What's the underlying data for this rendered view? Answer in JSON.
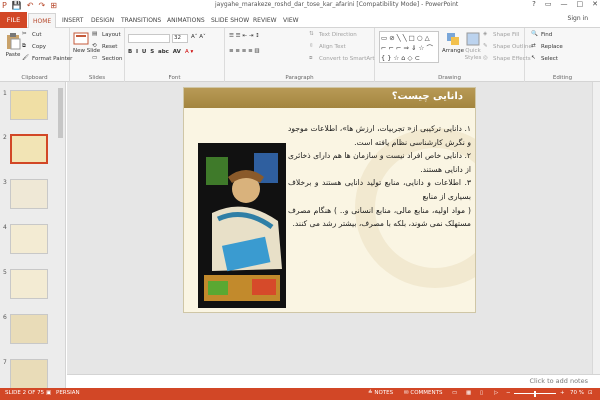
{
  "titlebar": {
    "title": "jaygahe_marakeze_roshd_dar_tose_kar_afarini [Compatibility Mode] - PowerPoint",
    "qat": [
      "P",
      "💾",
      "↶",
      "↷",
      "⊞"
    ],
    "controls": [
      "?",
      "▭",
      "—",
      "□",
      "✕"
    ]
  },
  "tabs": {
    "file": "FILE",
    "items": [
      "HOME",
      "INSERT",
      "DESIGN",
      "TRANSITIONS",
      "ANIMATIONS",
      "SLIDE SHOW",
      "REVIEW",
      "VIEW"
    ],
    "signin": "Sign in"
  },
  "ribbon": {
    "clipboard": {
      "paste": "Paste",
      "cut": "Cut",
      "copy": "Copy",
      "format_painter": "Format Painter",
      "label": "Clipboard"
    },
    "slides": {
      "new_slide": "New Slide",
      "layout": "Layout",
      "reset": "Reset",
      "section": "Section",
      "label": "Slides"
    },
    "font": {
      "size": "32",
      "label": "Font"
    },
    "paragraph": {
      "text_direction": "Text Direction",
      "align_text": "Align Text",
      "convert_smartart": "Convert to SmartArt",
      "label": "Paragraph"
    },
    "drawing": {
      "arrange": "Arrange",
      "quick_styles": "Quick Styles",
      "shape_fill": "Shape Fill",
      "shape_outline": "Shape Outline",
      "shape_effects": "Shape Effects",
      "label": "Drawing"
    },
    "editing": {
      "find": "Find",
      "replace": "Replace",
      "select": "Select",
      "label": "Editing"
    }
  },
  "thumbnails": [
    "1",
    "2",
    "3",
    "4",
    "5",
    "6",
    "7"
  ],
  "slide": {
    "title": "دانایی چیست؟",
    "points": [
      "۱.  دانایی ترکیبی از« تجربیات، ارزش ها»، اطلاعات موجود و نگرش کارشناسی نظام یافته است.",
      "۲.  دانایی خاص افراد نیست و سازمان ها هم دارای ذخائری از دانایی هستند.",
      "۳.  اطلاعات و دانایی، منابع تولید دانایی هستند و برخلاف بسیاری از منابع",
      "( مواد اولیه، منابع مالی، منابع انسانی و.. ) هنگام مصرف مستهلک نمی شوند، بلکه با مصرف، بیشتر رشد می کنند."
    ]
  },
  "notes": {
    "placeholder": "Click to add notes"
  },
  "status": {
    "slide": "SLIDE 2 OF 75",
    "language": "PERSIAN",
    "notes": "NOTES",
    "comments": "COMMENTS",
    "zoom": "70 %"
  }
}
